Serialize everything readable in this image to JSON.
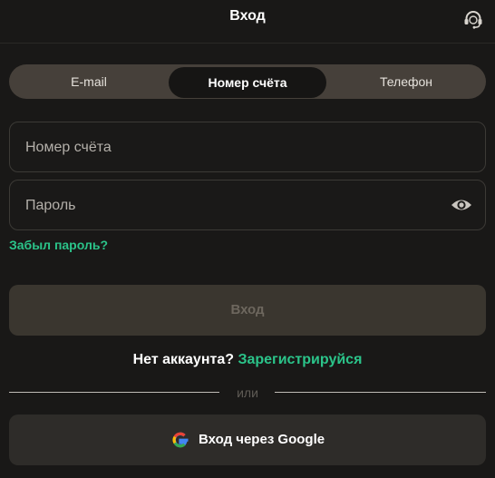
{
  "header": {
    "title": "Вход",
    "support_icon": "headset-icon"
  },
  "tabs": [
    {
      "label": "E-mail",
      "active": false
    },
    {
      "label": "Номер счёта",
      "active": true
    },
    {
      "label": "Телефон",
      "active": false
    }
  ],
  "form": {
    "account_placeholder": "Номер счёта",
    "account_value": "",
    "password_placeholder": "Пароль",
    "password_value": "",
    "password_toggle_icon": "eye-icon",
    "forgot_label": "Забыл пароль?",
    "submit_label": "Вход"
  },
  "register": {
    "prompt": "Нет аккаунта?",
    "link_label": "Зарегистрируйся"
  },
  "divider": {
    "label": "или"
  },
  "google": {
    "label": "Вход через Google",
    "icon": "google-icon"
  },
  "colors": {
    "background": "#191817",
    "accent": "#2bc48a",
    "tab_bar": "#46403a",
    "disabled_button": "#3a362f"
  }
}
